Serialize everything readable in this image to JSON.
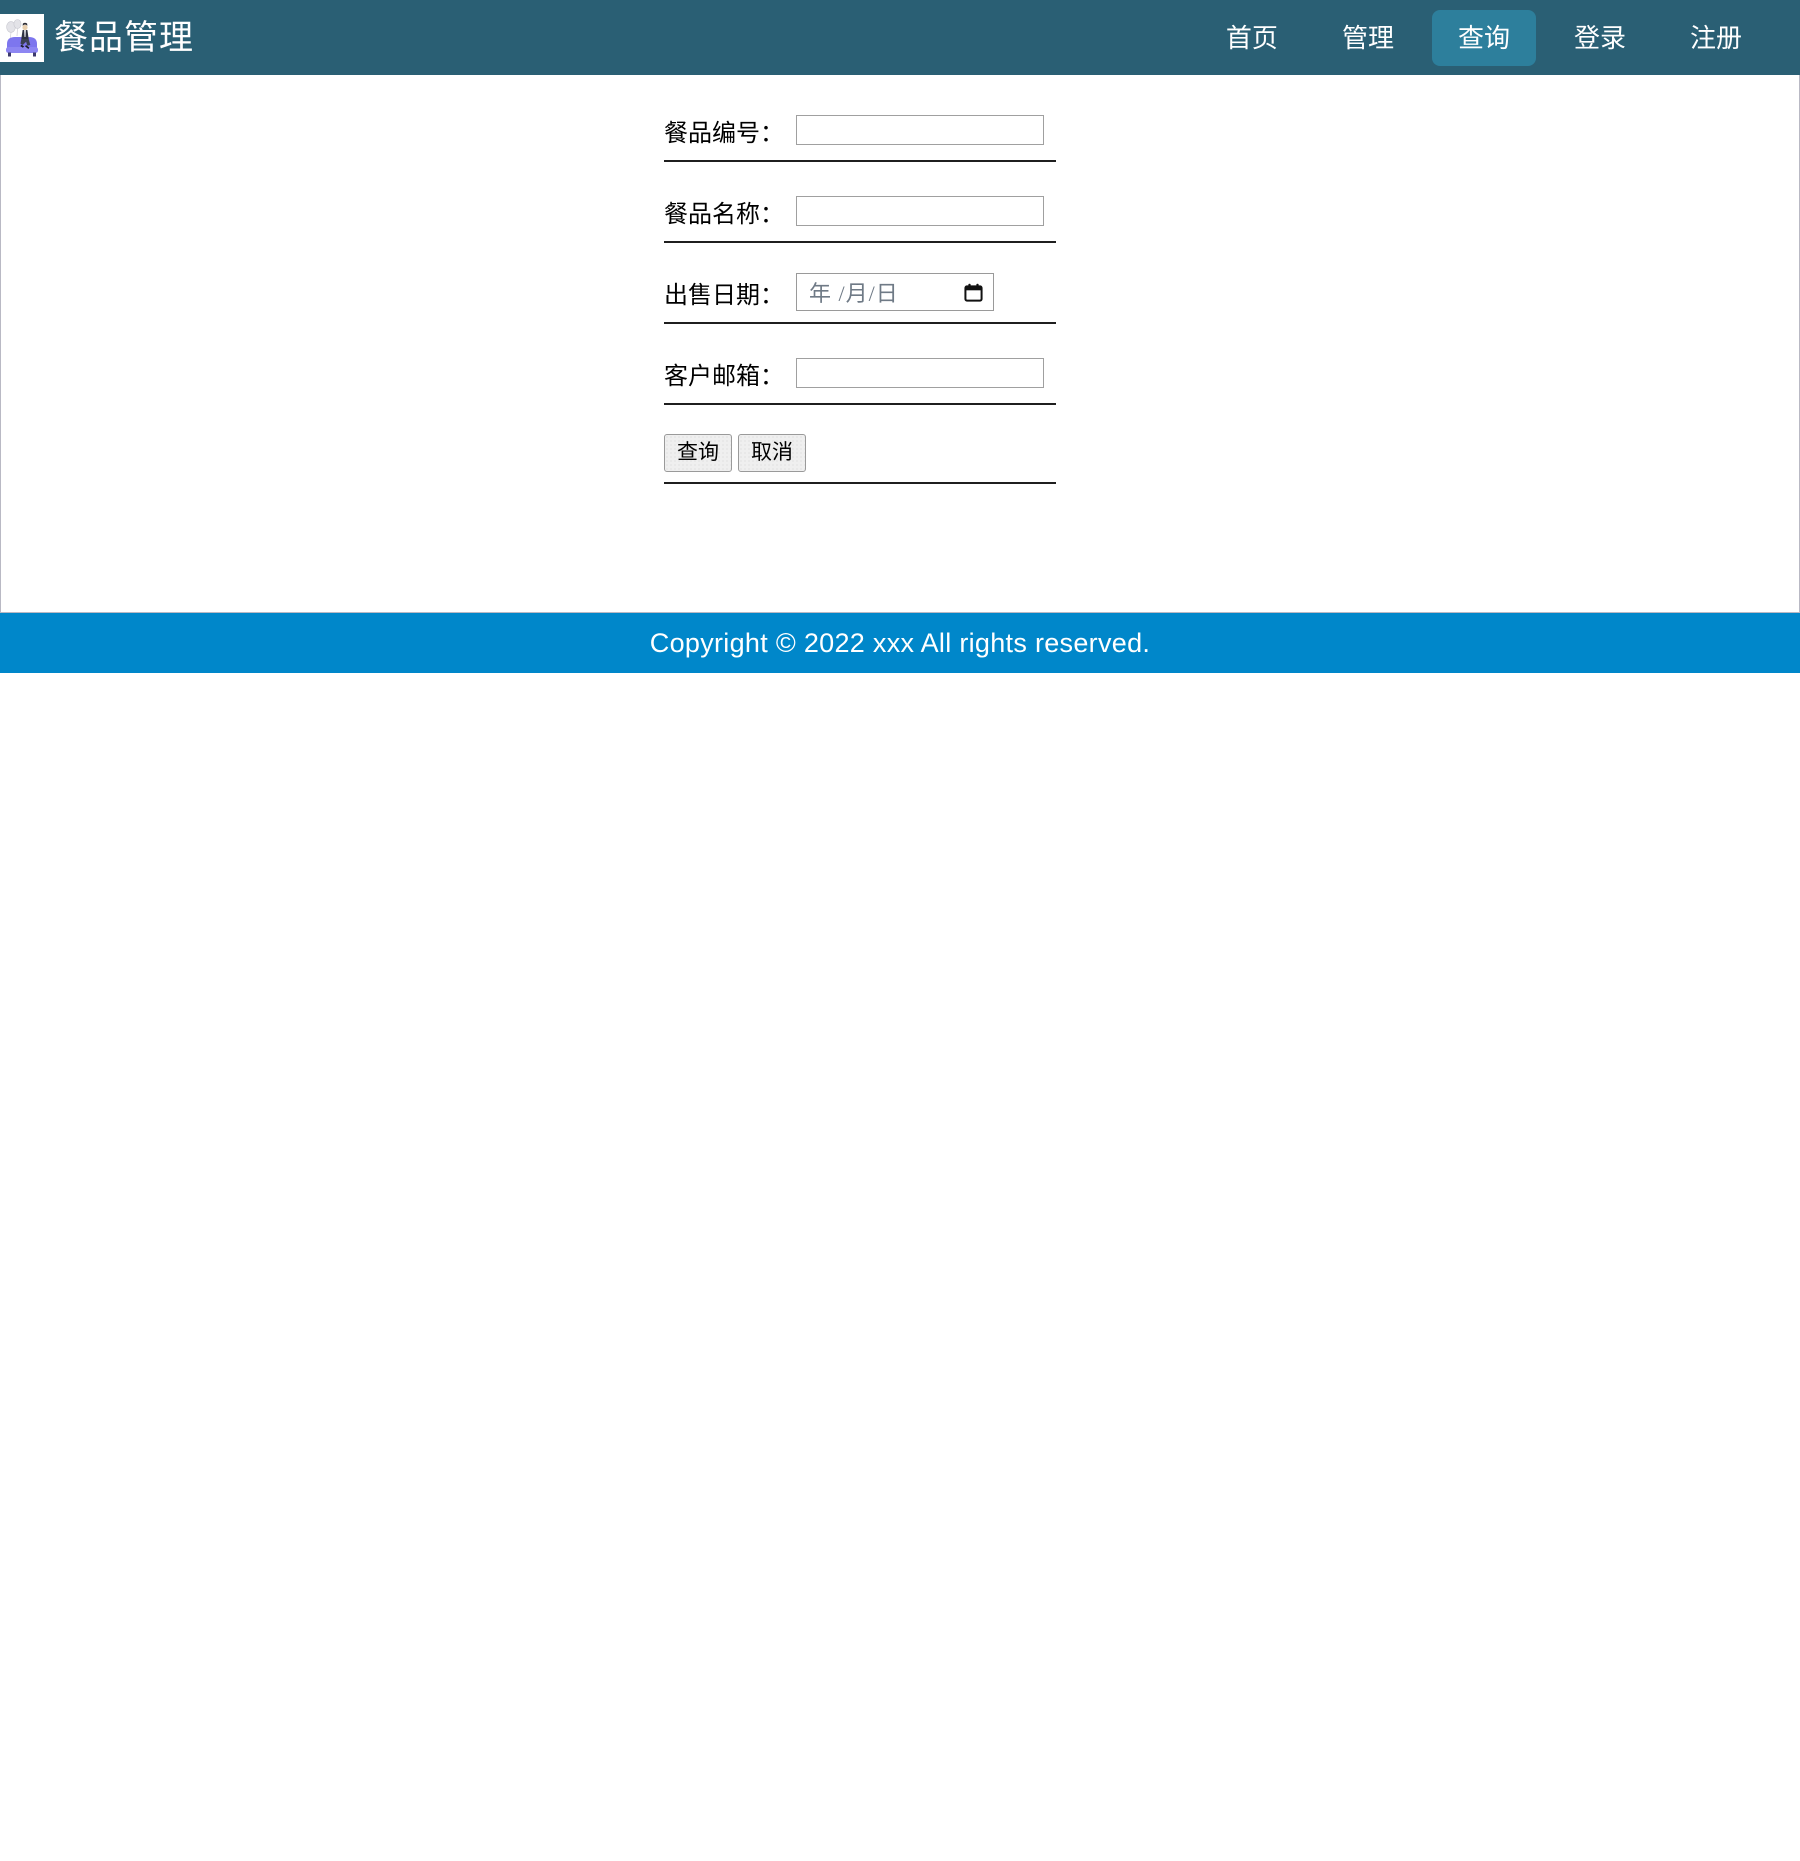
{
  "header": {
    "logo_icon": "person-on-sofa-logo",
    "title": "餐品管理",
    "background_color": "#2a5f74",
    "active_color": "#2d7f9c",
    "nav": [
      {
        "label": "首页",
        "active": false
      },
      {
        "label": "管理",
        "active": false
      },
      {
        "label": "查询",
        "active": true
      },
      {
        "label": "登录",
        "active": false
      },
      {
        "label": "注册",
        "active": false
      }
    ]
  },
  "form": {
    "fields": [
      {
        "label": "餐品编号：",
        "type": "text",
        "value": "",
        "placeholder": ""
      },
      {
        "label": "餐品名称：",
        "type": "text",
        "value": "",
        "placeholder": ""
      },
      {
        "label": "出售日期：",
        "type": "date",
        "value": "",
        "placeholder": "年 /月/日",
        "icon": "calendar-icon"
      },
      {
        "label": "客户邮箱：",
        "type": "text",
        "value": "",
        "placeholder": ""
      }
    ],
    "buttons": [
      {
        "label": "查询",
        "name": "submit"
      },
      {
        "label": "取消",
        "name": "cancel"
      }
    ]
  },
  "footer": {
    "text": "Copyright © 2022 xxx All rights reserved.",
    "background_color": "#0087ca"
  }
}
